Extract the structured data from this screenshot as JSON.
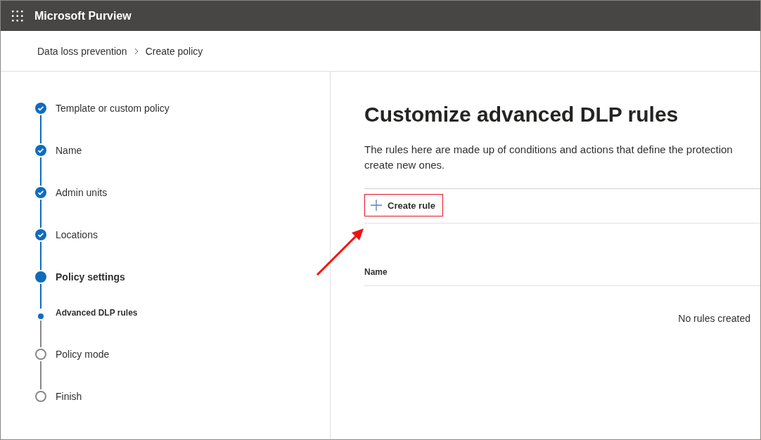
{
  "app": {
    "title": "Microsoft Purview"
  },
  "breadcrumb": [
    "Data loss prevention",
    "Create policy"
  ],
  "steps": [
    {
      "label": "Template or custom policy",
      "kind": "step",
      "completed": true,
      "selected": false
    },
    {
      "label": "Name",
      "kind": "step",
      "completed": true,
      "selected": false
    },
    {
      "label": "Admin units",
      "kind": "step",
      "completed": true,
      "selected": false
    },
    {
      "label": "Locations",
      "kind": "step",
      "completed": true,
      "selected": false
    },
    {
      "label": "Policy settings",
      "kind": "step",
      "completed": false,
      "selected": true
    },
    {
      "label": "Advanced DLP rules",
      "kind": "substep",
      "completed": false,
      "selected": true
    },
    {
      "label": "Policy mode",
      "kind": "step",
      "completed": false,
      "selected": false
    },
    {
      "label": "Finish",
      "kind": "step",
      "completed": false,
      "selected": false
    }
  ],
  "page": {
    "title": "Customize advanced DLP rules",
    "description_lines": [
      "The rules here are made up of conditions and actions that define the protection",
      "create new ones."
    ],
    "create_button": {
      "label": "Create rule",
      "highlighted": true
    },
    "table": {
      "columns": [
        "Name"
      ],
      "empty_text": "No rules created"
    }
  }
}
